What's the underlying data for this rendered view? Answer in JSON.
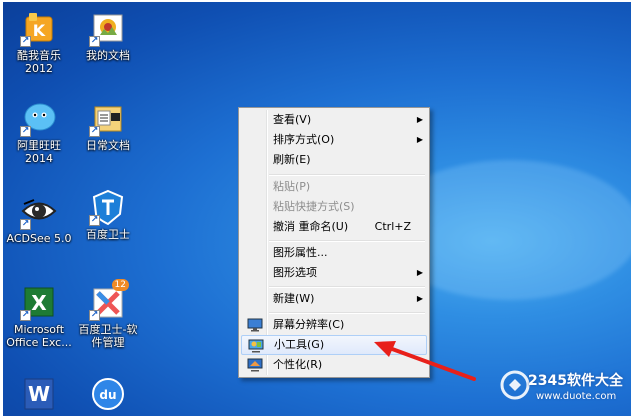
{
  "desktop_icons": [
    {
      "name": "kuwo-music-icon",
      "label": "酷我音乐\n2012"
    },
    {
      "name": "my-documents-icon",
      "label": "我的文档"
    },
    {
      "name": "aliwangwang-icon",
      "label": "阿里旺旺\n2014"
    },
    {
      "name": "daily-docs-icon",
      "label": "日常文档"
    },
    {
      "name": "acdsee-icon",
      "label": "ACDSee 5.0"
    },
    {
      "name": "baidu-guard-icon",
      "label": "百度卫士"
    },
    {
      "name": "excel-icon",
      "label": "Microsoft\nOffice Exc..."
    },
    {
      "name": "baidu-guard-software-icon",
      "label": "百度卫士-软\n件管理",
      "badge": "12"
    }
  ],
  "context_menu": {
    "items": [
      {
        "label": "查看(V)",
        "submenu": true
      },
      {
        "label": "排序方式(O)",
        "submenu": true
      },
      {
        "label": "刷新(E)"
      },
      {
        "label": "粘贴(P)",
        "disabled": true
      },
      {
        "label": "粘贴快捷方式(S)",
        "disabled": true
      },
      {
        "label": "撤消 重命名(U)",
        "shortcut": "Ctrl+Z"
      },
      {
        "label": "图形属性..."
      },
      {
        "label": "图形选项",
        "submenu": true
      },
      {
        "label": "新建(W)",
        "submenu": true
      },
      {
        "label": "屏幕分辨率(C)",
        "icon": "screen-resolution-icon"
      },
      {
        "label": "小工具(G)",
        "icon": "gadgets-icon",
        "highlighted": true
      },
      {
        "label": "个性化(R)",
        "icon": "personalize-icon"
      }
    ]
  },
  "watermark": {
    "brand": "2345软件大全",
    "url": "www.duote.com"
  },
  "colors": {
    "accent_arrow": "#e8201a",
    "desktop_blue": "#1d6fd2",
    "menu_bg": "#f0f0f0"
  }
}
